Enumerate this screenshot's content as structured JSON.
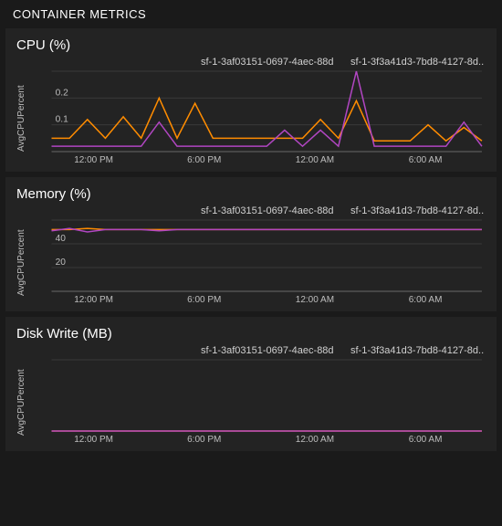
{
  "panel_title": "CONTAINER METRICS",
  "legend": {
    "series_a": "sf-1-3af03151-0697-4aec-88d...",
    "series_b": "sf-1-3f3a41d3-7bd8-4127-8d..."
  },
  "x_ticks": [
    "12:00 PM",
    "6:00 PM",
    "12:00 AM",
    "6:00 AM"
  ],
  "charts": {
    "cpu": {
      "title": "CPU (%)",
      "ylabel": "AvgCPUPercent"
    },
    "mem": {
      "title": "Memory (%)",
      "ylabel": "AvgCPUPercent"
    },
    "disk": {
      "title": "Disk Write (MB)",
      "ylabel": "AvgCPUPercent"
    }
  },
  "chart_data": [
    {
      "type": "line",
      "title": "CPU (%)",
      "ylabel": "AvgCPUPercent",
      "xlabel": "",
      "ylim": [
        0,
        0.3
      ],
      "x_categories": [
        "12:00 PM",
        "6:00 PM",
        "12:00 AM",
        "6:00 AM"
      ],
      "y_ticks": [
        0.1,
        0.2
      ],
      "series": [
        {
          "name": "sf-1-3af03151-0697-4aec-88d...",
          "color": "#ff8c00",
          "x_idx": [
            0,
            1,
            2,
            3,
            4,
            5,
            6,
            7,
            8,
            9,
            10,
            11,
            12,
            13,
            14,
            15,
            16,
            17,
            18,
            19,
            20,
            21,
            22,
            23,
            24
          ],
          "values": [
            0.05,
            0.05,
            0.12,
            0.05,
            0.13,
            0.05,
            0.2,
            0.05,
            0.18,
            0.05,
            0.05,
            0.05,
            0.05,
            0.05,
            0.05,
            0.12,
            0.05,
            0.19,
            0.04,
            0.04,
            0.04,
            0.1,
            0.04,
            0.09,
            0.04
          ]
        },
        {
          "name": "sf-1-3f3a41d3-7bd8-4127-8d...",
          "color": "#b146c2",
          "x_idx": [
            0,
            1,
            2,
            3,
            4,
            5,
            6,
            7,
            8,
            9,
            10,
            11,
            12,
            13,
            14,
            15,
            16,
            17,
            18,
            19,
            20,
            21,
            22,
            23,
            24
          ],
          "values": [
            0.02,
            0.02,
            0.02,
            0.02,
            0.02,
            0.02,
            0.11,
            0.02,
            0.02,
            0.02,
            0.02,
            0.02,
            0.02,
            0.08,
            0.02,
            0.08,
            0.02,
            0.3,
            0.02,
            0.02,
            0.02,
            0.02,
            0.02,
            0.11,
            0.02
          ]
        }
      ]
    },
    {
      "type": "line",
      "title": "Memory (%)",
      "ylabel": "AvgCPUPercent",
      "xlabel": "",
      "ylim": [
        0,
        60
      ],
      "x_categories": [
        "12:00 PM",
        "6:00 PM",
        "12:00 AM",
        "6:00 AM"
      ],
      "y_ticks": [
        20,
        40
      ],
      "series": [
        {
          "name": "sf-1-3af03151-0697-4aec-88d...",
          "color": "#ff8c00",
          "x_idx": [
            0,
            1,
            2,
            3,
            4,
            5,
            6,
            7,
            8,
            9,
            10,
            11,
            12,
            13,
            14,
            15,
            16,
            17,
            18,
            19,
            20,
            21,
            22,
            23,
            24
          ],
          "values": [
            52,
            52,
            53,
            52,
            52,
            52,
            52,
            52,
            52,
            52,
            52,
            52,
            52,
            52,
            52,
            52,
            52,
            52,
            52,
            52,
            52,
            52,
            52,
            52,
            52
          ]
        },
        {
          "name": "sf-1-3f3a41d3-7bd8-4127-8d...",
          "color": "#b146c2",
          "x_idx": [
            0,
            1,
            2,
            3,
            4,
            5,
            6,
            7,
            8,
            9,
            10,
            11,
            12,
            13,
            14,
            15,
            16,
            17,
            18,
            19,
            20,
            21,
            22,
            23,
            24
          ],
          "values": [
            51,
            53,
            50,
            52,
            52,
            52,
            51,
            52,
            52,
            52,
            52,
            52,
            52,
            52,
            52,
            52,
            52,
            52,
            52,
            52,
            52,
            52,
            52,
            52,
            52
          ]
        }
      ]
    },
    {
      "type": "line",
      "title": "Disk Write (MB)",
      "ylabel": "AvgCPUPercent",
      "xlabel": "",
      "ylim": [
        0,
        1
      ],
      "x_categories": [
        "12:00 PM",
        "6:00 PM",
        "12:00 AM",
        "6:00 AM"
      ],
      "y_ticks": [],
      "series": [
        {
          "name": "sf-1-3af03151-0697-4aec-88d...",
          "color": "#ff8c00",
          "x_idx": [
            0,
            24
          ],
          "values": [
            0,
            0
          ]
        },
        {
          "name": "sf-1-3f3a41d3-7bd8-4127-8d...",
          "color": "#b146c2",
          "x_idx": [
            0,
            24
          ],
          "values": [
            0,
            0
          ]
        }
      ]
    }
  ]
}
